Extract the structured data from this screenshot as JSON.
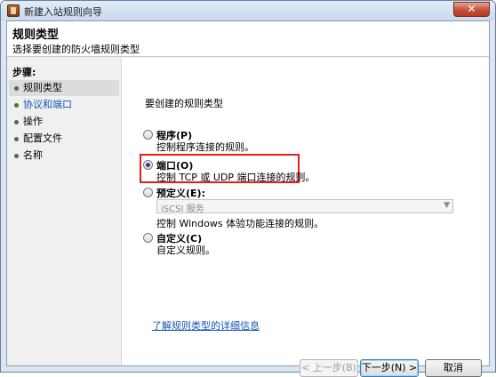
{
  "window": {
    "title": "新建入站规则向导",
    "close_glyph": "✕"
  },
  "header": {
    "title": "规则类型",
    "subtitle": "选择要创建的防火墙规则类型"
  },
  "steps": {
    "title": "步骤:",
    "items": [
      {
        "label": "规则类型"
      },
      {
        "label": "协议和端口"
      },
      {
        "label": "操作"
      },
      {
        "label": "配置文件"
      },
      {
        "label": "名称"
      }
    ]
  },
  "main": {
    "question": "要创建的规则类型",
    "options": [
      {
        "label": "程序(P)",
        "desc": "控制程序连接的规则。",
        "selected": false
      },
      {
        "label": "端口(O)",
        "desc": "控制 TCP 或 UDP 端口连接的规则。",
        "selected": true
      },
      {
        "label": "预定义(E):",
        "desc": "控制 Windows 体验功能连接的规则。",
        "selected": false
      },
      {
        "label": "自定义(C)",
        "desc": "自定义规则。",
        "selected": false
      }
    ],
    "predefined_select": {
      "value": "iSCSI 服务",
      "arrow": "▼"
    },
    "learn_more": "了解规则类型的详细信息"
  },
  "buttons": {
    "back": "< 上一步(B)",
    "next": "下一步(N) >",
    "cancel": "取消"
  },
  "colors": {
    "highlight": "#e02020",
    "link": "#1155bb",
    "step_dot": "#3a7a2c"
  }
}
